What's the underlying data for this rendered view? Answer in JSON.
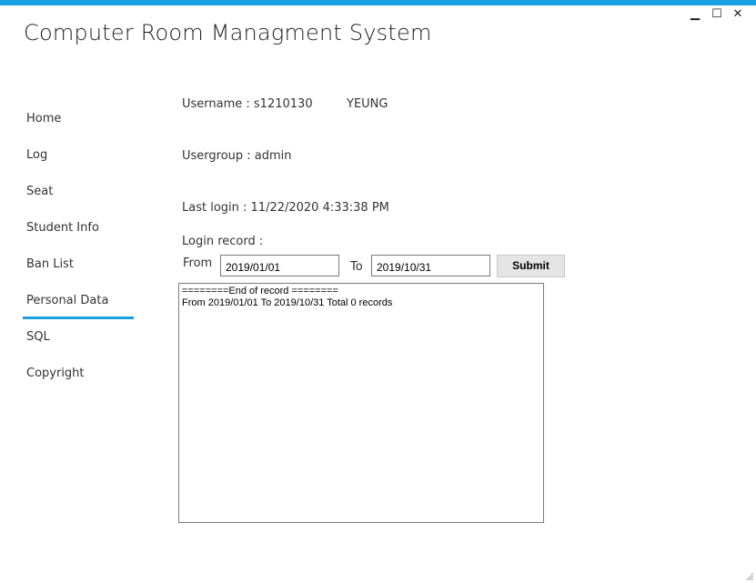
{
  "app_title": "Computer Room Managment System",
  "window_controls": {
    "minimize": "▁",
    "maximize": "☐",
    "close": "✕"
  },
  "nav": {
    "items": [
      "Home",
      "Log",
      "Seat",
      "Student Info",
      "Ban List",
      "Personal Data",
      "SQL",
      "Copyright"
    ],
    "selected": "Personal Data",
    "accent_color": "#1ba1e2"
  },
  "user": {
    "username_label": "Username : s1210130",
    "name": "YEUNG",
    "usergroup_label": "Usergroup : admin",
    "last_login_label": "Last login : 11/22/2020 4:33:38 PM"
  },
  "login_record": {
    "label": "Login record :",
    "from_label": "From",
    "from_value": "2019/01/01",
    "to_label": "To",
    "to_value": "2019/10/31",
    "submit_label": "Submit",
    "output_lines": [
      "========End of record ========",
      "From 2019/01/01 To 2019/10/31 Total 0 records"
    ]
  }
}
